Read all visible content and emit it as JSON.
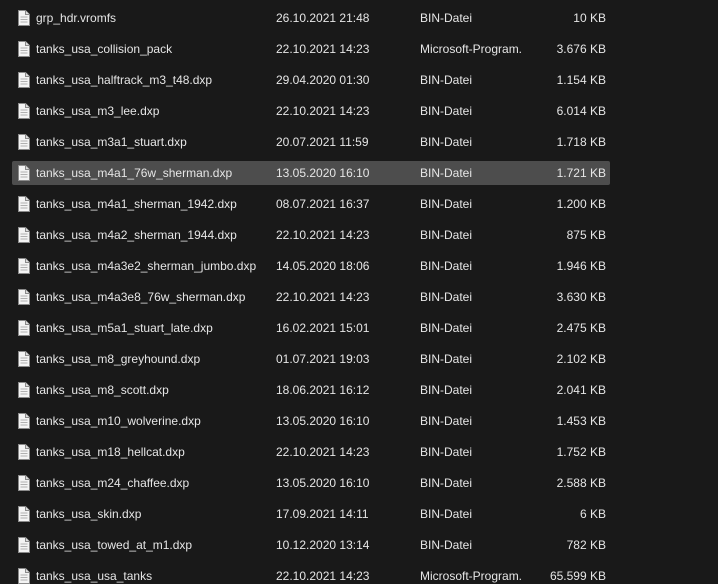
{
  "files": [
    {
      "name": "grp_hdr.vromfs",
      "date": "26.10.2021 21:48",
      "type": "BIN-Datei",
      "size": "10 KB",
      "icon": "file-icon"
    },
    {
      "name": "tanks_usa_collision_pack",
      "date": "22.10.2021 14:23",
      "type": "Microsoft-Program...",
      "size": "3.676 KB",
      "icon": "file-icon"
    },
    {
      "name": "tanks_usa_halftrack_m3_t48.dxp",
      "date": "29.04.2020 01:30",
      "type": "BIN-Datei",
      "size": "1.154 KB",
      "icon": "file-icon"
    },
    {
      "name": "tanks_usa_m3_lee.dxp",
      "date": "22.10.2021 14:23",
      "type": "BIN-Datei",
      "size": "6.014 KB",
      "icon": "file-icon"
    },
    {
      "name": "tanks_usa_m3a1_stuart.dxp",
      "date": "20.07.2021 11:59",
      "type": "BIN-Datei",
      "size": "1.718 KB",
      "icon": "file-icon"
    },
    {
      "name": "tanks_usa_m4a1_76w_sherman.dxp",
      "date": "13.05.2020 16:10",
      "type": "BIN-Datei",
      "size": "1.721 KB",
      "icon": "file-icon",
      "selected": true
    },
    {
      "name": "tanks_usa_m4a1_sherman_1942.dxp",
      "date": "08.07.2021 16:37",
      "type": "BIN-Datei",
      "size": "1.200 KB",
      "icon": "file-icon"
    },
    {
      "name": "tanks_usa_m4a2_sherman_1944.dxp",
      "date": "22.10.2021 14:23",
      "type": "BIN-Datei",
      "size": "875 KB",
      "icon": "file-icon"
    },
    {
      "name": "tanks_usa_m4a3e2_sherman_jumbo.dxp",
      "date": "14.05.2020 18:06",
      "type": "BIN-Datei",
      "size": "1.946 KB",
      "icon": "file-icon"
    },
    {
      "name": "tanks_usa_m4a3e8_76w_sherman.dxp",
      "date": "22.10.2021 14:23",
      "type": "BIN-Datei",
      "size": "3.630 KB",
      "icon": "file-icon"
    },
    {
      "name": "tanks_usa_m5a1_stuart_late.dxp",
      "date": "16.02.2021 15:01",
      "type": "BIN-Datei",
      "size": "2.475 KB",
      "icon": "file-icon"
    },
    {
      "name": "tanks_usa_m8_greyhound.dxp",
      "date": "01.07.2021 19:03",
      "type": "BIN-Datei",
      "size": "2.102 KB",
      "icon": "file-icon"
    },
    {
      "name": "tanks_usa_m8_scott.dxp",
      "date": "18.06.2021 16:12",
      "type": "BIN-Datei",
      "size": "2.041 KB",
      "icon": "file-icon"
    },
    {
      "name": "tanks_usa_m10_wolverine.dxp",
      "date": "13.05.2020 16:10",
      "type": "BIN-Datei",
      "size": "1.453 KB",
      "icon": "file-icon"
    },
    {
      "name": "tanks_usa_m18_hellcat.dxp",
      "date": "22.10.2021 14:23",
      "type": "BIN-Datei",
      "size": "1.752 KB",
      "icon": "file-icon"
    },
    {
      "name": "tanks_usa_m24_chaffee.dxp",
      "date": "13.05.2020 16:10",
      "type": "BIN-Datei",
      "size": "2.588 KB",
      "icon": "file-icon"
    },
    {
      "name": "tanks_usa_skin.dxp",
      "date": "17.09.2021 14:11",
      "type": "BIN-Datei",
      "size": "6 KB",
      "icon": "file-icon"
    },
    {
      "name": "tanks_usa_towed_at_m1.dxp",
      "date": "10.12.2020 13:14",
      "type": "BIN-Datei",
      "size": "782 KB",
      "icon": "file-icon"
    },
    {
      "name": "tanks_usa_usa_tanks",
      "date": "22.10.2021 14:23",
      "type": "Microsoft-Program...",
      "size": "65.599 KB",
      "icon": "file-icon"
    }
  ]
}
